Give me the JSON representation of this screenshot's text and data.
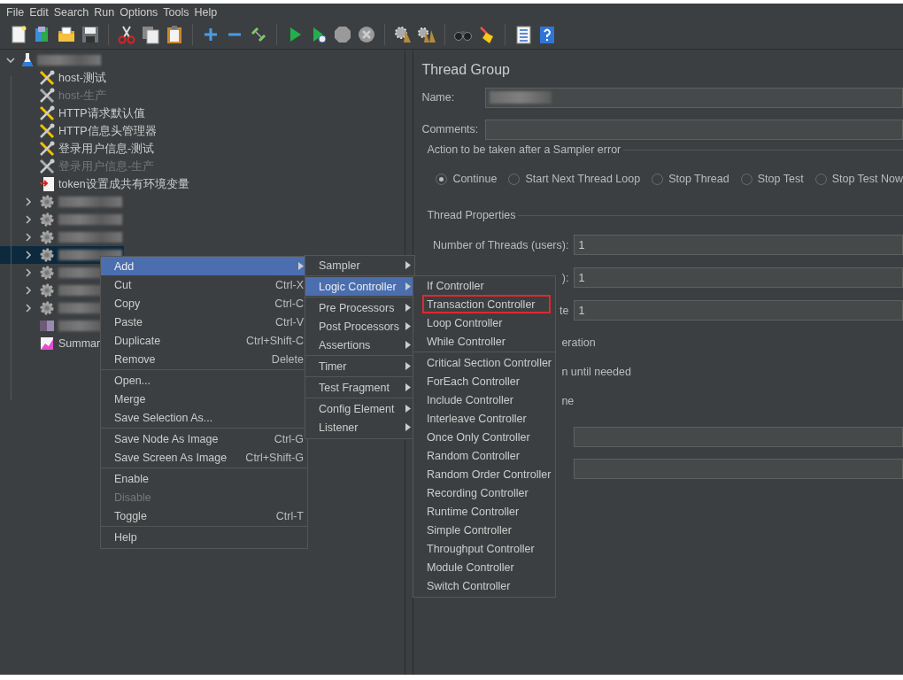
{
  "menubar": [
    "File",
    "Edit",
    "Search",
    "Run",
    "Options",
    "Tools",
    "Help"
  ],
  "tree": {
    "kind": "test_plan",
    "expanded": true,
    "selected": false,
    "children": [
      {
        "kind": "config",
        "label": "host-测试",
        "selected": false,
        "disabled": false
      },
      {
        "kind": "config",
        "label": "host-生产",
        "selected": false,
        "disabled": true
      },
      {
        "kind": "config",
        "label": "HTTP请求默认值",
        "selected": false,
        "disabled": false
      },
      {
        "kind": "config",
        "label": "HTTP信息头管理器",
        "selected": false,
        "disabled": false
      },
      {
        "kind": "config",
        "label": "登录用户信息-测试",
        "selected": false,
        "disabled": false
      },
      {
        "kind": "config",
        "label": "登录用户信息-生产",
        "selected": false,
        "disabled": true
      },
      {
        "kind": "preprocessor",
        "label": "token设置成共有环境变量",
        "selected": false,
        "disabled": false
      },
      {
        "kind": "thread_group",
        "expanded": false,
        "selected": false
      },
      {
        "kind": "thread_group",
        "expanded": false,
        "selected": false
      },
      {
        "kind": "thread_group",
        "expanded": false,
        "selected": false
      },
      {
        "kind": "thread_group",
        "expanded": false,
        "selected": true
      },
      {
        "kind": "thread_group",
        "expanded": false,
        "selected": false
      },
      {
        "kind": "thread_group",
        "expanded": false,
        "selected": false
      },
      {
        "kind": "thread_group",
        "expanded": false,
        "selected": false
      },
      {
        "kind": "plain",
        "selected": false
      },
      {
        "kind": "listener",
        "label": "Summar",
        "selected": false,
        "disabled": false
      }
    ]
  },
  "panel": {
    "title": "Thread Group",
    "name_label": "Name:",
    "comments_label": "Comments:",
    "error_action": {
      "legend": "Action to be taken after a Sampler error",
      "options": [
        {
          "label": "Continue",
          "selected": true
        },
        {
          "label": "Start Next Thread Loop",
          "selected": false
        },
        {
          "label": "Stop Thread",
          "selected": false
        },
        {
          "label": "Stop Test",
          "selected": false
        },
        {
          "label": "Stop Test Now",
          "selected": false
        }
      ]
    },
    "thread_properties": {
      "legend": "Thread Properties",
      "rows": [
        {
          "label": "Number of Threads (users):",
          "value": "1"
        },
        {
          "label": "):",
          "value": "1"
        },
        {
          "label": "te",
          "value": "1"
        }
      ],
      "notes": [
        "eration",
        "n until needed",
        "ne"
      ]
    }
  },
  "context_menu": {
    "groups": [
      [
        {
          "label": "Add",
          "submenu": true,
          "selected": true,
          "disabled": false
        },
        {
          "label": "Cut",
          "shortcut": "Ctrl-X",
          "submenu": false,
          "selected": false,
          "disabled": false
        },
        {
          "label": "Copy",
          "shortcut": "Ctrl-C",
          "submenu": false,
          "selected": false,
          "disabled": false
        },
        {
          "label": "Paste",
          "shortcut": "Ctrl-V",
          "submenu": false,
          "selected": false,
          "disabled": false
        },
        {
          "label": "Duplicate",
          "shortcut": "Ctrl+Shift-C",
          "submenu": false,
          "selected": false,
          "disabled": false
        },
        {
          "label": "Remove",
          "shortcut": "Delete",
          "submenu": false,
          "selected": false,
          "disabled": false
        }
      ],
      [
        {
          "label": "Open...",
          "submenu": false,
          "selected": false,
          "disabled": false
        },
        {
          "label": "Merge",
          "submenu": false,
          "selected": false,
          "disabled": false
        },
        {
          "label": "Save Selection As...",
          "submenu": false,
          "selected": false,
          "disabled": false
        }
      ],
      [
        {
          "label": "Save Node As Image",
          "shortcut": "Ctrl-G",
          "submenu": false,
          "selected": false,
          "disabled": false
        },
        {
          "label": "Save Screen As Image",
          "shortcut": "Ctrl+Shift-G",
          "submenu": false,
          "selected": false,
          "disabled": false
        }
      ],
      [
        {
          "label": "Enable",
          "submenu": false,
          "selected": false,
          "disabled": false
        },
        {
          "label": "Disable",
          "submenu": false,
          "selected": false,
          "disabled": true
        },
        {
          "label": "Toggle",
          "shortcut": "Ctrl-T",
          "submenu": false,
          "selected": false,
          "disabled": false
        }
      ],
      [
        {
          "label": "Help",
          "submenu": false,
          "selected": false,
          "disabled": false
        }
      ]
    ]
  },
  "add_menu": {
    "groups": [
      [
        {
          "label": "Sampler",
          "submenu": true,
          "selected": false
        }
      ],
      [
        {
          "label": "Logic Controller",
          "submenu": true,
          "selected": true
        }
      ],
      [
        {
          "label": "Pre Processors",
          "submenu": true,
          "selected": false
        },
        {
          "label": "Post Processors",
          "submenu": true,
          "selected": false
        },
        {
          "label": "Assertions",
          "submenu": true,
          "selected": false
        }
      ],
      [
        {
          "label": "Timer",
          "submenu": true,
          "selected": false
        }
      ],
      [
        {
          "label": "Test Fragment",
          "submenu": true,
          "selected": false
        }
      ],
      [
        {
          "label": "Config Element",
          "submenu": true,
          "selected": false
        },
        {
          "label": "Listener",
          "submenu": true,
          "selected": false
        }
      ]
    ]
  },
  "logic_controller_menu": {
    "groups": [
      [
        {
          "label": "If Controller",
          "selected": false,
          "outlined": false
        },
        {
          "label": "Transaction Controller",
          "selected": false,
          "outlined": true
        },
        {
          "label": "Loop Controller",
          "selected": false,
          "outlined": false
        },
        {
          "label": "While Controller",
          "selected": false,
          "outlined": false
        }
      ],
      [
        {
          "label": "Critical Section Controller",
          "selected": false,
          "outlined": false
        },
        {
          "label": "ForEach Controller",
          "selected": false,
          "outlined": false
        },
        {
          "label": "Include Controller",
          "selected": false,
          "outlined": false
        },
        {
          "label": "Interleave Controller",
          "selected": false,
          "outlined": false
        },
        {
          "label": "Once Only Controller",
          "selected": false,
          "outlined": false
        },
        {
          "label": "Random Controller",
          "selected": false,
          "outlined": false
        },
        {
          "label": "Random Order Controller",
          "selected": false,
          "outlined": false
        },
        {
          "label": "Recording Controller",
          "selected": false,
          "outlined": false
        },
        {
          "label": "Runtime Controller",
          "selected": false,
          "outlined": false
        },
        {
          "label": "Simple Controller",
          "selected": false,
          "outlined": false
        },
        {
          "label": "Throughput Controller",
          "selected": false,
          "outlined": false
        },
        {
          "label": "Module Controller",
          "selected": false,
          "outlined": false
        },
        {
          "label": "Switch Controller",
          "selected": false,
          "outlined": false
        }
      ]
    ]
  }
}
